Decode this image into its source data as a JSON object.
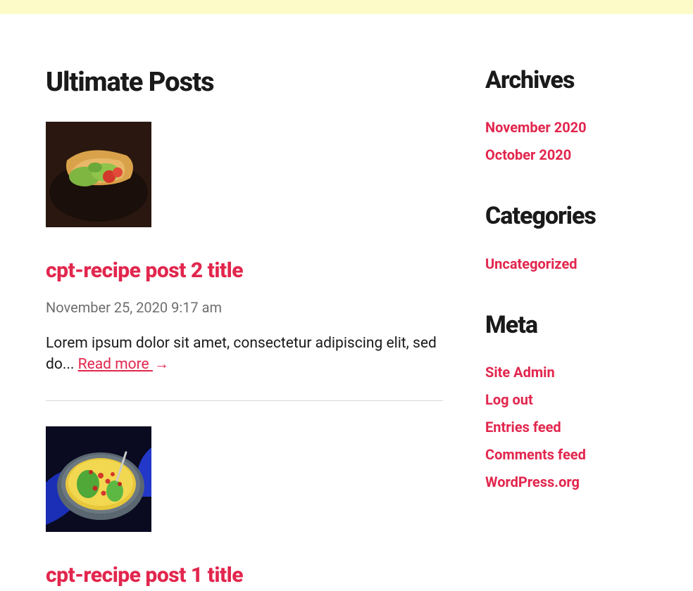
{
  "main": {
    "section_title": "Ultimate Posts",
    "posts": [
      {
        "title": "cpt-recipe post 2 title",
        "date": "November 25, 2020 9:17 am",
        "excerpt_prefix": "Lorem ipsum dolor sit amet, consectetur adipiscing elit, sed do... ",
        "read_more": "Read more",
        "arrow": "→"
      },
      {
        "title": "cpt-recipe post 1 title"
      }
    ]
  },
  "sidebar": {
    "archives": {
      "title": "Archives",
      "items": [
        "November 2020",
        "October 2020"
      ]
    },
    "categories": {
      "title": "Categories",
      "items": [
        "Uncategorized"
      ]
    },
    "meta": {
      "title": "Meta",
      "items": [
        "Site Admin",
        "Log out",
        "Entries feed",
        "Comments feed",
        "WordPress.org"
      ]
    }
  }
}
